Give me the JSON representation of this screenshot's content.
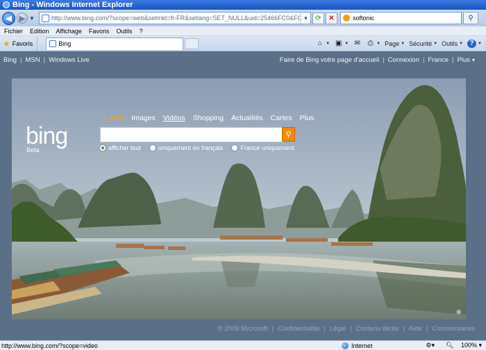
{
  "window": {
    "title": "Bing - Windows Internet Explorer"
  },
  "addressbar": {
    "url": "http://www.bing.com/?scope=web&setmkt=fr-FR&setlang=SET_NULL&uid=25466FC0&FORM=W5WA",
    "search_value": "softonic"
  },
  "menu": [
    "Fichier",
    "Edition",
    "Affichage",
    "Favoris",
    "Outils",
    "?"
  ],
  "favorites": {
    "label": "Favoris"
  },
  "tab": {
    "title": "Bing"
  },
  "toolbar": {
    "page": "Page",
    "security": "Sécurité",
    "tools": "Outils",
    "help": "?"
  },
  "topnav": {
    "left": [
      "Bing",
      "MSN",
      "Windows Live"
    ],
    "right": [
      "Faire de Bing votre page d'accueil",
      "Connexion",
      "France",
      "Plus"
    ],
    "more_arrow": "▾"
  },
  "bing": {
    "logo": "bing",
    "beta": "Beta",
    "scopes": [
      "Web",
      "Images",
      "Vidéos",
      "Shopping",
      "Actualités",
      "Cartes",
      "Plus"
    ],
    "search_placeholder": "",
    "radios": [
      "afficher tout",
      "uniquement en français",
      "France uniquement"
    ]
  },
  "footer": [
    "© 2009 Microsoft",
    "Confidentialité",
    "Légal",
    "Contenu illicite",
    "Aide",
    "Commentaires"
  ],
  "statusbar": {
    "url": "http://www.bing.com/?scope=video",
    "zone": "Internet",
    "zoom": "100%"
  }
}
